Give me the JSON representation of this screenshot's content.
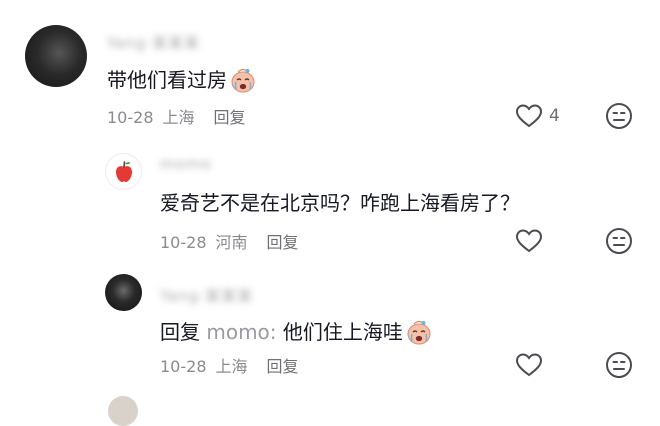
{
  "comments": [
    {
      "username": "Yang·某某某",
      "text": "带他们看过房",
      "date": "10-28",
      "location": "上海",
      "reply_label": "回复",
      "like_count": "4"
    },
    {
      "username": "momo",
      "text": "爱奇艺不是在北京吗？咋跑上海看房了？",
      "date": "10-28",
      "location": "河南",
      "reply_label": "回复"
    },
    {
      "username": "Yang·某某某",
      "reply_prefix": "回复",
      "mention": "momo:",
      "text": "他们住上海哇",
      "date": "10-28",
      "location": "上海",
      "reply_label": "回复"
    }
  ],
  "icons": {
    "like": "heart-outline-icon",
    "dislike": "neutral-face-icon",
    "emoji": "crying-face-emoji",
    "apple_avatar": "red-apple-icon"
  },
  "colors": {
    "primary_text": "#161823",
    "secondary_text": "#8a8b91",
    "mention": "#9a9aa0"
  }
}
